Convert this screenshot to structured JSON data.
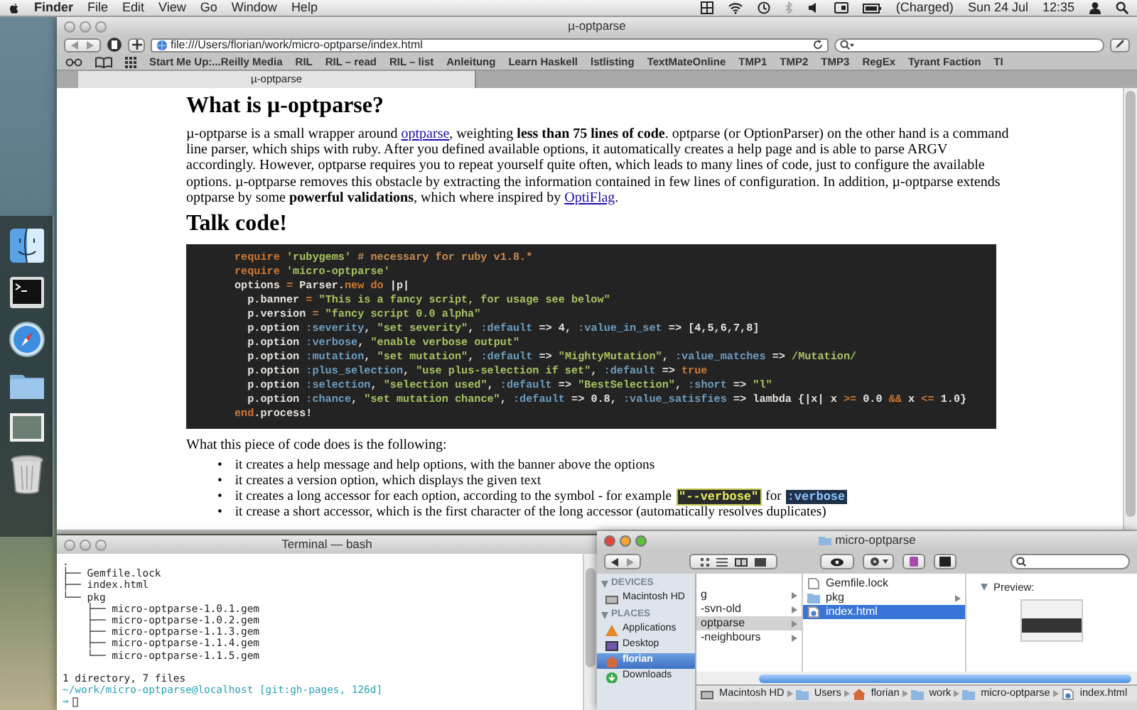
{
  "menu_bar": {
    "app": "Finder",
    "items": [
      "File",
      "Edit",
      "View",
      "Go",
      "Window",
      "Help"
    ],
    "battery": "(Charged)",
    "date": "Sun 24 Jul",
    "time": "12:35"
  },
  "browser": {
    "title": "µ-optparse",
    "address": "file:///Users/florian/work/micro-optparse/index.html",
    "bookmarks": [
      "Start Me Up:...Reilly Media",
      "RIL",
      "RIL – read",
      "RIL – list",
      "Anleitung",
      "Learn Haskell",
      "lstlisting",
      "TextMateOnline",
      "TMP1",
      "TMP2",
      "TMP3",
      "RegEx",
      "Tyrant Faction",
      "TI"
    ],
    "tabs": [
      {
        "label": "µ-optparse",
        "selected": true
      }
    ],
    "page": {
      "heading": "What is µ-optparse?",
      "paragraph": [
        {
          "kind": "text",
          "text": "µ-optparse is a small wrapper around "
        },
        {
          "kind": "link",
          "text": "optparse"
        },
        {
          "kind": "text",
          "text": ", weighting **less than 75 lines of code**. optparse (or OptionParser) on the other hand is a command line parser, which ships with ruby. After you defined available options, it automatically creates a help page and is able to parse ARGV accordingly. However, optparse requires you to repeat yourself quite often, which leads to many lines of code, just to configure the available options. µ-optparse removes this obstacle by extracting the information contained in few lines of configuration. In addition, µ-optparse extends optparse by some **powerful validations**, which where inspired by "
        },
        {
          "kind": "link",
          "text": "OptiFlag"
        },
        {
          "kind": "text",
          "text": "."
        }
      ],
      "heading_2": "Talk code!",
      "code": [
        [
          {
            "kind": "kw",
            "text": "require"
          },
          {
            "kind": "str",
            "text": " 'rubygems'"
          },
          {
            "kind": "comment",
            "text": " # necessary for ruby v1.8.*"
          }
        ],
        [
          {
            "kind": "kw",
            "text": "require"
          },
          {
            "kind": "str",
            "text": " 'micro-optparse'"
          }
        ],
        [
          {
            "kind": "plain",
            "text": "options "
          },
          {
            "kind": "kw",
            "text": "="
          },
          {
            "kind": "plain",
            "text": " Parser."
          },
          {
            "kind": "kw",
            "text": "new"
          },
          {
            "kind": "kw",
            "text": " do"
          },
          {
            "kind": "plain",
            "text": " |p|"
          }
        ],
        [
          {
            "kind": "plain",
            "text": "  p.banner "
          },
          {
            "kind": "kw",
            "text": "="
          },
          {
            "kind": "str",
            "text": " \"This is a fancy script, for usage see below\""
          }
        ],
        [
          {
            "kind": "plain",
            "text": "  p.version "
          },
          {
            "kind": "kw",
            "text": "="
          },
          {
            "kind": "str",
            "text": " \"fancy script 0.0 alpha\""
          }
        ],
        [
          {
            "kind": "plain",
            "text": "  p.option "
          },
          {
            "kind": "sym",
            "text": ":severity"
          },
          {
            "kind": "plain",
            "text": ", "
          },
          {
            "kind": "str",
            "text": "\"set severity\""
          },
          {
            "kind": "plain",
            "text": ", "
          },
          {
            "kind": "sym",
            "text": ":default"
          },
          {
            "kind": "plain",
            "text": " => 4, "
          },
          {
            "kind": "sym",
            "text": ":value_in_set"
          },
          {
            "kind": "plain",
            "text": " => [4,5,6,7,8]"
          }
        ],
        [
          {
            "kind": "plain",
            "text": "  p.option "
          },
          {
            "kind": "sym",
            "text": ":verbose"
          },
          {
            "kind": "plain",
            "text": ", "
          },
          {
            "kind": "str",
            "text": "\"enable verbose output\""
          }
        ],
        [
          {
            "kind": "plain",
            "text": "  p.option "
          },
          {
            "kind": "sym",
            "text": ":mutation"
          },
          {
            "kind": "plain",
            "text": ", "
          },
          {
            "kind": "str",
            "text": "\"set mutation\""
          },
          {
            "kind": "plain",
            "text": ", "
          },
          {
            "kind": "sym",
            "text": ":default"
          },
          {
            "kind": "plain",
            "text": " => "
          },
          {
            "kind": "str",
            "text": "\"MightyMutation\""
          },
          {
            "kind": "plain",
            "text": ", "
          },
          {
            "kind": "sym",
            "text": ":value_matches"
          },
          {
            "kind": "plain",
            "text": " => "
          },
          {
            "kind": "str",
            "text": "/Mutation/"
          }
        ],
        [
          {
            "kind": "plain",
            "text": "  p.option "
          },
          {
            "kind": "sym",
            "text": ":plus_selection"
          },
          {
            "kind": "plain",
            "text": ", "
          },
          {
            "kind": "str",
            "text": "\"use plus-selection if set\""
          },
          {
            "kind": "plain",
            "text": ", "
          },
          {
            "kind": "sym",
            "text": ":default"
          },
          {
            "kind": "plain",
            "text": " => "
          },
          {
            "kind": "kw",
            "text": "true"
          }
        ],
        [
          {
            "kind": "plain",
            "text": "  p.option "
          },
          {
            "kind": "sym",
            "text": ":selection"
          },
          {
            "kind": "plain",
            "text": ", "
          },
          {
            "kind": "str",
            "text": "\"selection used\""
          },
          {
            "kind": "plain",
            "text": ", "
          },
          {
            "kind": "sym",
            "text": ":default"
          },
          {
            "kind": "plain",
            "text": " => "
          },
          {
            "kind": "str",
            "text": "\"BestSelection\""
          },
          {
            "kind": "plain",
            "text": ", "
          },
          {
            "kind": "sym",
            "text": ":short"
          },
          {
            "kind": "plain",
            "text": " => "
          },
          {
            "kind": "str",
            "text": "\"l\""
          }
        ],
        [
          {
            "kind": "plain",
            "text": "  p.option "
          },
          {
            "kind": "sym",
            "text": ":chance"
          },
          {
            "kind": "plain",
            "text": ", "
          },
          {
            "kind": "str",
            "text": "\"set mutation chance\""
          },
          {
            "kind": "plain",
            "text": ", "
          },
          {
            "kind": "sym",
            "text": ":default"
          },
          {
            "kind": "plain",
            "text": " => 0.8, "
          },
          {
            "kind": "sym",
            "text": ":value_satisfies"
          },
          {
            "kind": "plain",
            "text": " => lambda {|x| x "
          },
          {
            "kind": "kw",
            "text": ">="
          },
          {
            "kind": "plain",
            "text": " 0.0 "
          },
          {
            "kind": "kw",
            "text": "&&"
          },
          {
            "kind": "plain",
            "text": " x "
          },
          {
            "kind": "kw",
            "text": "<="
          },
          {
            "kind": "plain",
            "text": " 1.0}"
          }
        ],
        [
          {
            "kind": "kw",
            "text": "end"
          },
          {
            "kind": "plain",
            "text": ".process!"
          }
        ]
      ],
      "intro": "What this piece of code does is the following:",
      "bullets": [
        {
          "marker": "•",
          "parts": [
            {
              "kind": "text",
              "text": "it creates a help message and help options, with the banner above the options"
            }
          ]
        },
        {
          "marker": "•",
          "parts": [
            {
              "kind": "text",
              "text": "it creates a version option, which displays the given text"
            }
          ]
        },
        {
          "marker": "•",
          "parts": [
            {
              "kind": "text",
              "text": "it creates a long accessor for each option, according to the symbol - for example"
            },
            {
              "kind": "code_string",
              "text": "\"--verbose\""
            },
            {
              "kind": "text",
              "text": "for"
            },
            {
              "kind": "code_symbol",
              "text": ":verbose"
            }
          ]
        },
        {
          "marker": "•",
          "parts": [
            {
              "kind": "text",
              "text": "it crease a short accessor, which is the first character of the long accessor (automatically resolves duplicates)"
            }
          ]
        }
      ]
    }
  },
  "terminal": {
    "title": "Terminal — bash",
    "lines": [
      {
        "kind": "output",
        "text": "."
      },
      {
        "kind": "output",
        "text": "├── Gemfile.lock"
      },
      {
        "kind": "output",
        "text": "├── index.html"
      },
      {
        "kind": "output",
        "text": "└── pkg"
      },
      {
        "kind": "output",
        "text": "    ├── micro-optparse-1.0.1.gem"
      },
      {
        "kind": "output",
        "text": "    ├── micro-optparse-1.0.2.gem"
      },
      {
        "kind": "output",
        "text": "    ├── micro-optparse-1.1.3.gem"
      },
      {
        "kind": "output",
        "text": "    ├── micro-optparse-1.1.4.gem"
      },
      {
        "kind": "output",
        "text": "    └── micro-optparse-1.1.5.gem"
      },
      {
        "kind": "summary",
        "text": "1 directory, 7 files"
      },
      {
        "kind": "path",
        "text": "~/work/micro-optparse@localhost [git:gh-pages, 126d]"
      },
      {
        "kind": "prompt",
        "text": "→"
      }
    ]
  },
  "finder": {
    "title": "micro-optparse",
    "sidebar": [
      {
        "header": "DEVICES",
        "items": [
          {
            "kind": "disk",
            "label": "Macintosh HD",
            "selected": false
          }
        ]
      },
      {
        "header": "PLACES",
        "items": [
          {
            "kind": "applications",
            "label": "Applications",
            "selected": false
          },
          {
            "kind": "desktop",
            "label": "Desktop",
            "selected": false
          },
          {
            "kind": "home",
            "label": "florian",
            "selected": true
          },
          {
            "kind": "downloads",
            "label": "Downloads",
            "selected": false
          }
        ]
      }
    ],
    "column_1": [
      {
        "label": "g",
        "selected": false
      },
      {
        "label": "-svn-old",
        "selected": false
      },
      {
        "label": "optparse",
        "selected": true
      },
      {
        "label": "-neighbours",
        "selected": false
      }
    ],
    "column_2": [
      {
        "kind": "file",
        "label": "Gemfile.lock",
        "selected": false
      },
      {
        "kind": "folder",
        "label": "pkg",
        "selected": false
      },
      {
        "kind": "html",
        "label": "index.html",
        "selected": true
      }
    ],
    "preview_label": "Preview:",
    "path": [
      {
        "kind": "disk",
        "label": "Macintosh HD"
      },
      {
        "kind": "folder",
        "label": "Users"
      },
      {
        "kind": "home",
        "label": "florian"
      },
      {
        "kind": "folder",
        "label": "work"
      },
      {
        "kind": "folder",
        "label": "micro-optparse"
      },
      {
        "kind": "html",
        "label": "index.html"
      }
    ]
  }
}
